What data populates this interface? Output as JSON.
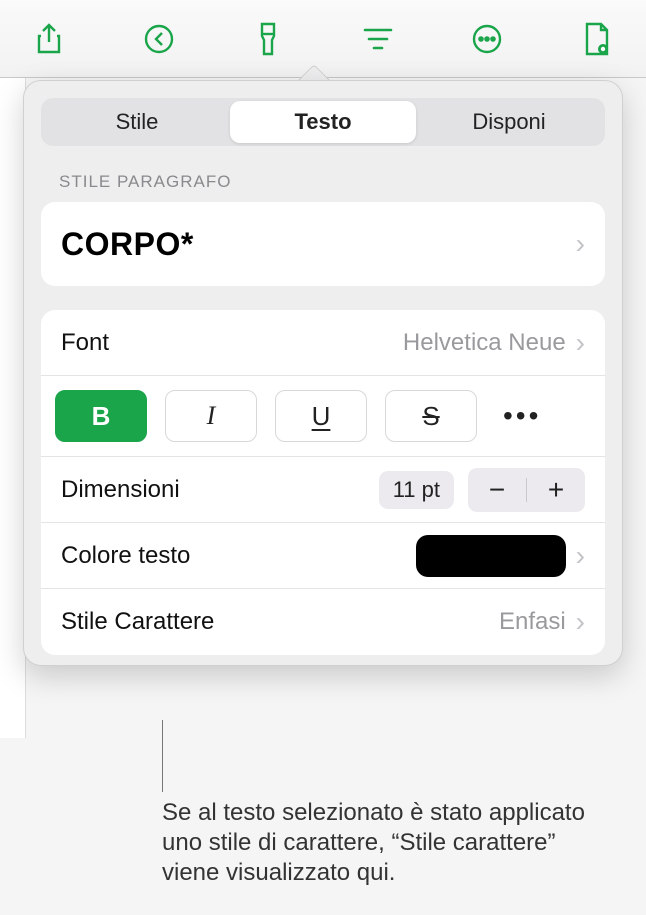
{
  "toolbar": {
    "icons": [
      "share-icon",
      "undo-icon",
      "format-brush-icon",
      "filter-icon",
      "more-icon",
      "document-view-icon"
    ]
  },
  "tabs": {
    "items": [
      "Stile",
      "Testo",
      "Disponi"
    ],
    "active_index": 1
  },
  "paragraph": {
    "section_label": "Stile Paragrafo",
    "style_name": "CORPO*"
  },
  "text": {
    "font_label": "Font",
    "font_value": "Helvetica Neue",
    "styles": {
      "bold_active": true
    },
    "size_label": "Dimensioni",
    "size_value": "11 pt",
    "color_label": "Colore testo",
    "color_value": "#000000",
    "char_style_label": "Stile Carattere",
    "char_style_value": "Enfasi"
  },
  "callout": {
    "text": "Se al testo selezionato è stato applicato uno stile di carattere, “Stile carattere” viene visualizzato qui."
  }
}
